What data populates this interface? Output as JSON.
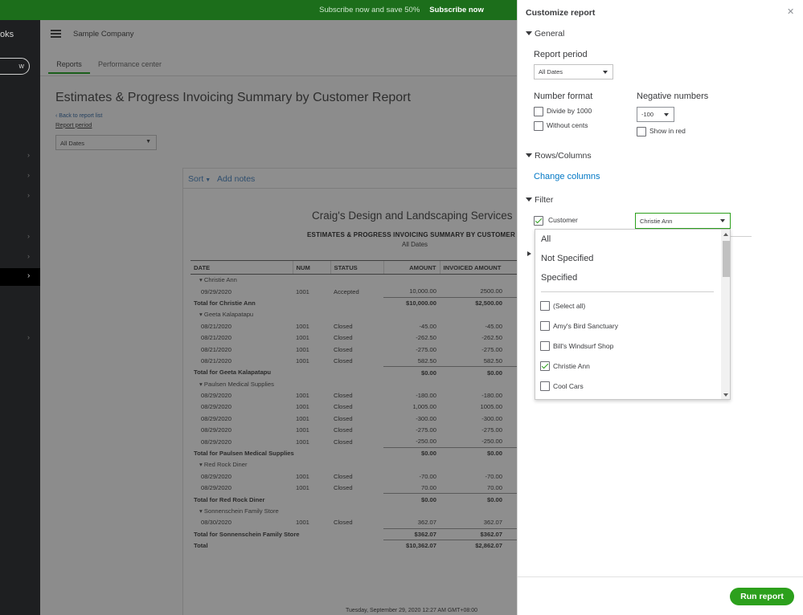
{
  "promo": {
    "text": "Subscribe now and save 50%",
    "cta": "Subscribe now"
  },
  "leftnav": {
    "brand": "oks",
    "new_label": "w"
  },
  "header": {
    "company": "Sample Company",
    "tabs": [
      "Reports",
      "Performance center"
    ]
  },
  "report_page": {
    "title": "Estimates & Progress Invoicing Summary by Customer Report",
    "back_link": "Back to report list",
    "period_label": "Report period",
    "period_value": "All Dates"
  },
  "report": {
    "toolbar": {
      "sort": "Sort",
      "notes": "Add notes"
    },
    "company_name": "Craig's Design and Landscaping Services",
    "heading": "ESTIMATES & PROGRESS INVOICING SUMMARY BY CUSTOMER",
    "dates": "All Dates",
    "columns": [
      "DATE",
      "NUM",
      "STATUS",
      "AMOUNT",
      "INVOICED AMOUNT"
    ],
    "rows": [
      {
        "type": "group",
        "label": "Christie Ann"
      },
      {
        "type": "row",
        "cells": [
          "09/29/2020",
          "1001",
          "Accepted",
          "10,000.00",
          "2500.00"
        ]
      },
      {
        "type": "total",
        "label": "Total for Christie Ann",
        "amount": "$10,000.00",
        "invoiced": "$2,500.00"
      },
      {
        "type": "group",
        "label": "Geeta Kalapatapu"
      },
      {
        "type": "row",
        "cells": [
          "08/21/2020",
          "1001",
          "Closed",
          "-45.00",
          "-45.00"
        ]
      },
      {
        "type": "row",
        "cells": [
          "08/21/2020",
          "1001",
          "Closed",
          "-262.50",
          "-262.50"
        ]
      },
      {
        "type": "row",
        "cells": [
          "08/21/2020",
          "1001",
          "Closed",
          "-275.00",
          "-275.00"
        ]
      },
      {
        "type": "row",
        "cells": [
          "08/21/2020",
          "1001",
          "Closed",
          "582.50",
          "582.50"
        ]
      },
      {
        "type": "total",
        "label": "Total for Geeta Kalapatapu",
        "amount": "$0.00",
        "invoiced": "$0.00"
      },
      {
        "type": "group",
        "label": "Paulsen Medical Supplies"
      },
      {
        "type": "row",
        "cells": [
          "08/29/2020",
          "1001",
          "Closed",
          "-180.00",
          "-180.00"
        ]
      },
      {
        "type": "row",
        "cells": [
          "08/29/2020",
          "1001",
          "Closed",
          "1,005.00",
          "1005.00"
        ]
      },
      {
        "type": "row",
        "cells": [
          "08/29/2020",
          "1001",
          "Closed",
          "-300.00",
          "-300.00"
        ]
      },
      {
        "type": "row",
        "cells": [
          "08/29/2020",
          "1001",
          "Closed",
          "-275.00",
          "-275.00"
        ]
      },
      {
        "type": "row",
        "cells": [
          "08/29/2020",
          "1001",
          "Closed",
          "-250.00",
          "-250.00"
        ]
      },
      {
        "type": "total",
        "label": "Total for Paulsen Medical Supplies",
        "amount": "$0.00",
        "invoiced": "$0.00"
      },
      {
        "type": "group",
        "label": "Red Rock Diner"
      },
      {
        "type": "row",
        "cells": [
          "08/29/2020",
          "1001",
          "Closed",
          "-70.00",
          "-70.00"
        ]
      },
      {
        "type": "row",
        "cells": [
          "08/29/2020",
          "1001",
          "Closed",
          "70.00",
          "70.00"
        ]
      },
      {
        "type": "total",
        "label": "Total for Red Rock Diner",
        "amount": "$0.00",
        "invoiced": "$0.00"
      },
      {
        "type": "group",
        "label": "Sonnenschein Family Store"
      },
      {
        "type": "row",
        "cells": [
          "08/30/2020",
          "1001",
          "Closed",
          "362.07",
          "362.07"
        ]
      },
      {
        "type": "total",
        "label": "Total for Sonnenschein Family Store",
        "amount": "$362.07",
        "invoiced": "$362.07"
      },
      {
        "type": "grandtotal",
        "label": "Total",
        "amount": "$10,362.07",
        "invoiced": "$2,862.07"
      }
    ],
    "footer_stamp": "Tuesday, September 29, 2020   12:27 AM GMT+08:00"
  },
  "panel": {
    "title": "Customize report",
    "general": {
      "label": "General",
      "report_period_label": "Report period",
      "report_period_value": "All Dates",
      "number_format_label": "Number format",
      "divide_by_1000": "Divide by 1000",
      "without_cents": "Without cents",
      "negative_numbers_label": "Negative numbers",
      "negative_value": "-100",
      "show_in_red": "Show in red"
    },
    "rows_columns": {
      "label": "Rows/Columns",
      "change_columns": "Change columns"
    },
    "filter": {
      "label": "Filter",
      "customer_label": "Customer",
      "customer_value": "Christie Ann",
      "options": [
        "All",
        "Not Specified",
        "Specified"
      ],
      "items": [
        {
          "label": "(Select all)",
          "checked": false
        },
        {
          "label": "Amy's Bird Sanctuary",
          "checked": false
        },
        {
          "label": "Bill's Windsurf Shop",
          "checked": false
        },
        {
          "label": "Christie Ann",
          "checked": true
        },
        {
          "label": "Cool Cars",
          "checked": false
        }
      ]
    },
    "run_report": "Run report"
  },
  "colors": {
    "accent_green": "#2ca01c",
    "link_blue": "#0077c5",
    "banner_green": "#1c6e1b"
  }
}
